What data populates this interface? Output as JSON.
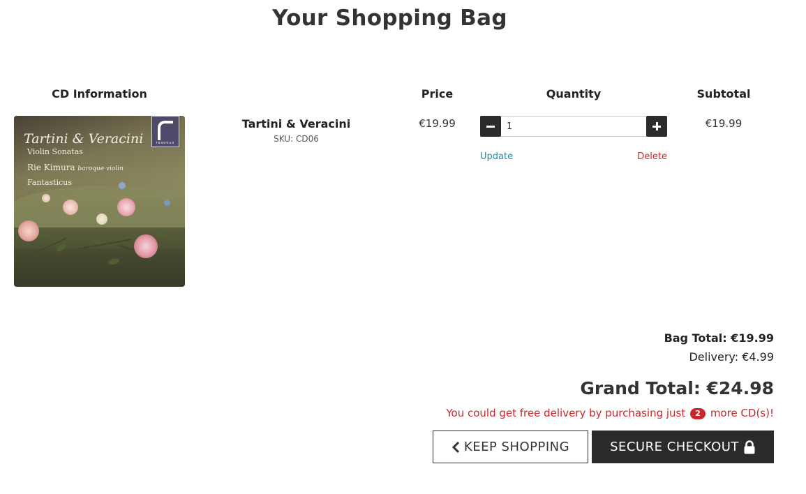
{
  "page": {
    "title": "Your Shopping Bag"
  },
  "table": {
    "headers": {
      "info": "CD Information",
      "price": "Price",
      "quantity": "Quantity",
      "subtotal": "Subtotal"
    }
  },
  "item": {
    "name": "Tartini & Veracini",
    "sku": "SKU: CD06",
    "price": "€19.99",
    "quantity": "1",
    "subtotal": "€19.99",
    "update_label": "Update",
    "delete_label": "Delete",
    "cover": {
      "title": "Tartini & Veracini",
      "subtitle": "Violin Sonatas",
      "performer": "Rie Kimura",
      "instrument": "baroque violin",
      "ensemble": "Fantasticus",
      "label_brand": "resonus"
    }
  },
  "summary": {
    "bag_total": "Bag Total: €19.99",
    "delivery": "Delivery: €4.99",
    "grand_total": "Grand Total: €24.98",
    "free_delivery_prefix": "You could get free delivery by purchasing just",
    "free_delivery_count": "2",
    "free_delivery_suffix": "more CD(s)!"
  },
  "actions": {
    "keep_shopping": "KEEP SHOPPING",
    "secure_checkout": "SECURE CHECKOUT"
  },
  "icons": {
    "minus": "minus-icon",
    "plus": "plus-icon",
    "back": "chevron-left-icon",
    "lock": "lock-icon"
  },
  "colors": {
    "danger": "#c8282d",
    "link": "#1a8fb0",
    "dark": "#2b2b2b"
  }
}
